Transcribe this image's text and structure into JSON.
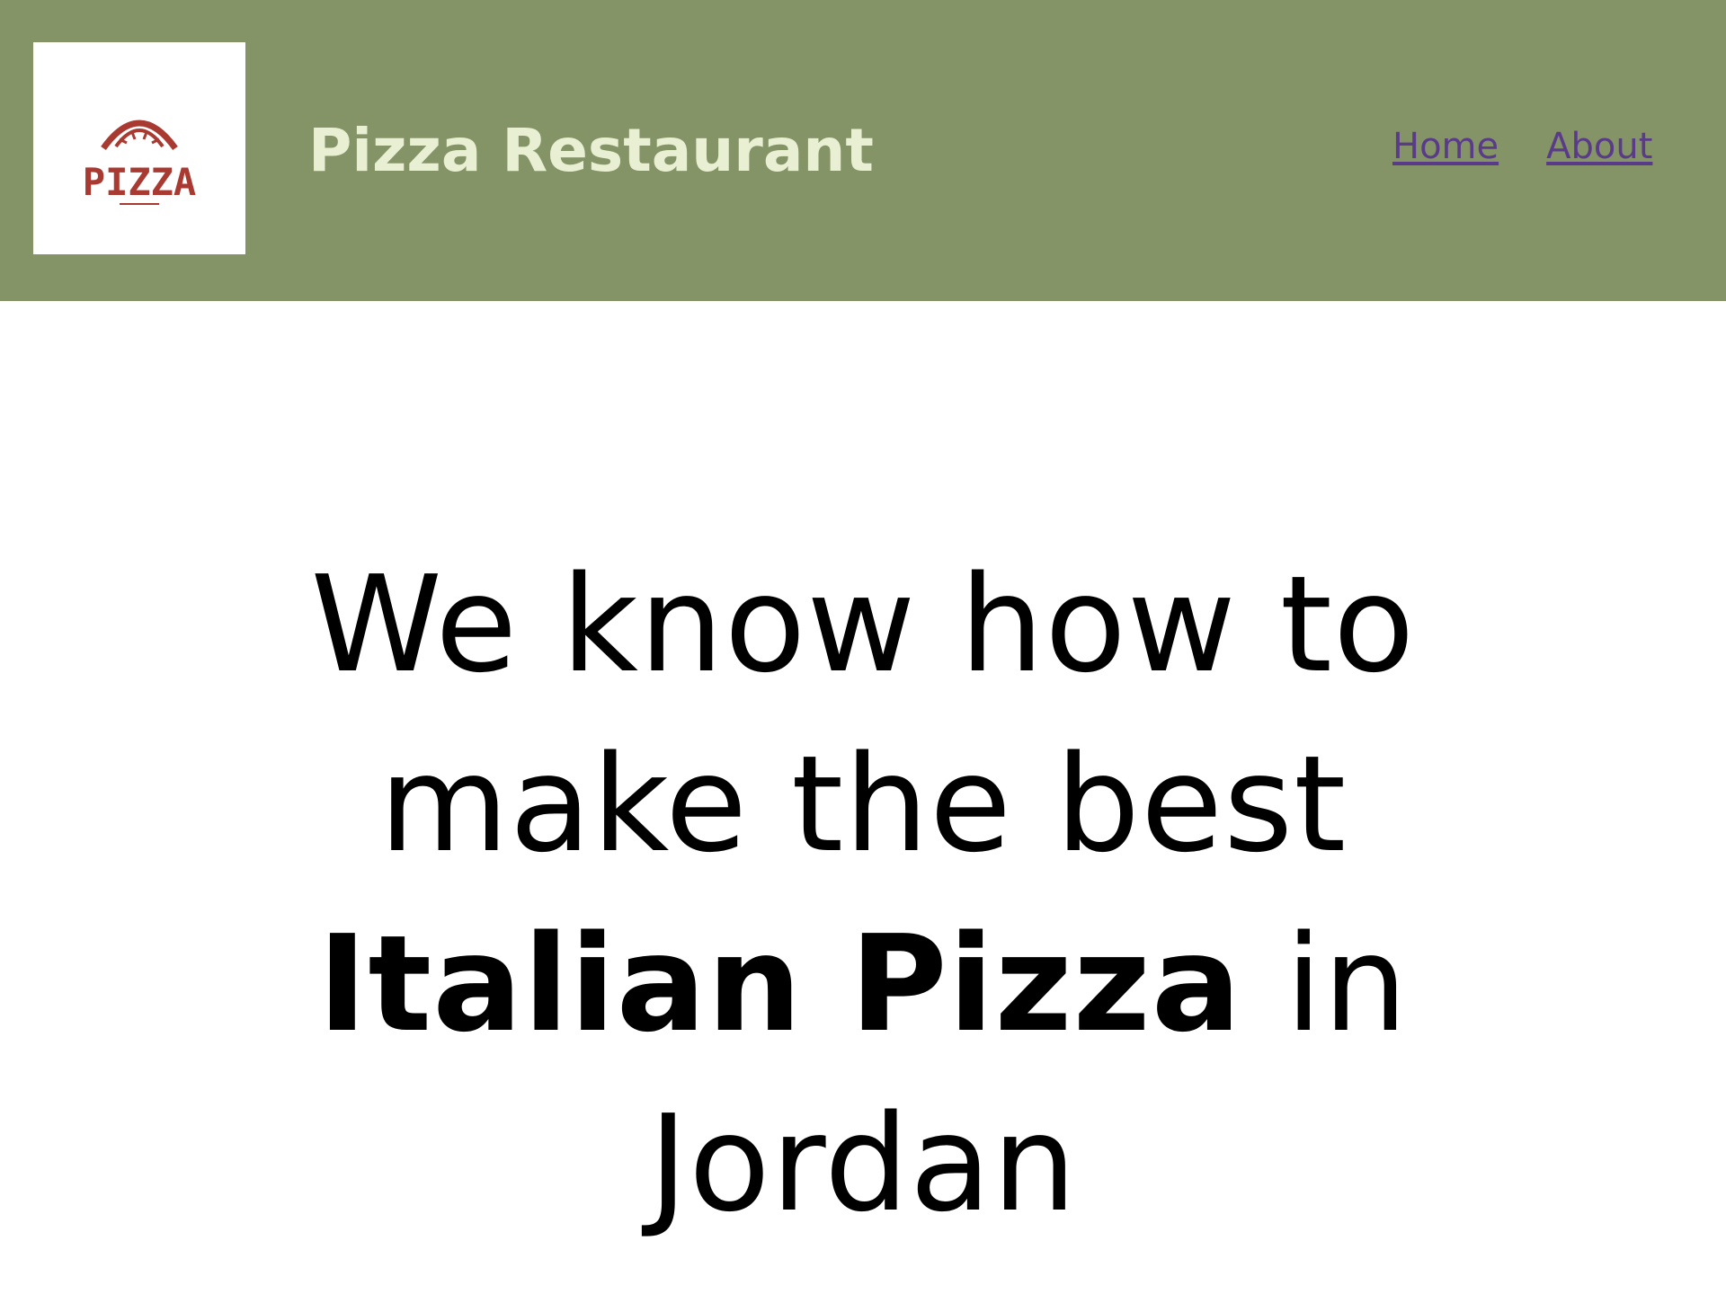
{
  "header": {
    "brand_name": "Pizza Restaurant",
    "logo": {
      "icon": "pizza-logo-icon",
      "text": "PIZZA"
    },
    "nav": [
      {
        "label": "Home"
      },
      {
        "label": "About"
      }
    ]
  },
  "hero": {
    "line1": "We know how to",
    "line2": "make the best",
    "emphasis": "Italian Pizza",
    "after_emphasis": " in",
    "line4": "Jordan"
  },
  "colors": {
    "header_bg": "#849466",
    "brand_text": "#e9efd2",
    "nav_link": "#5a3b8a",
    "logo_red": "#a83a32"
  }
}
